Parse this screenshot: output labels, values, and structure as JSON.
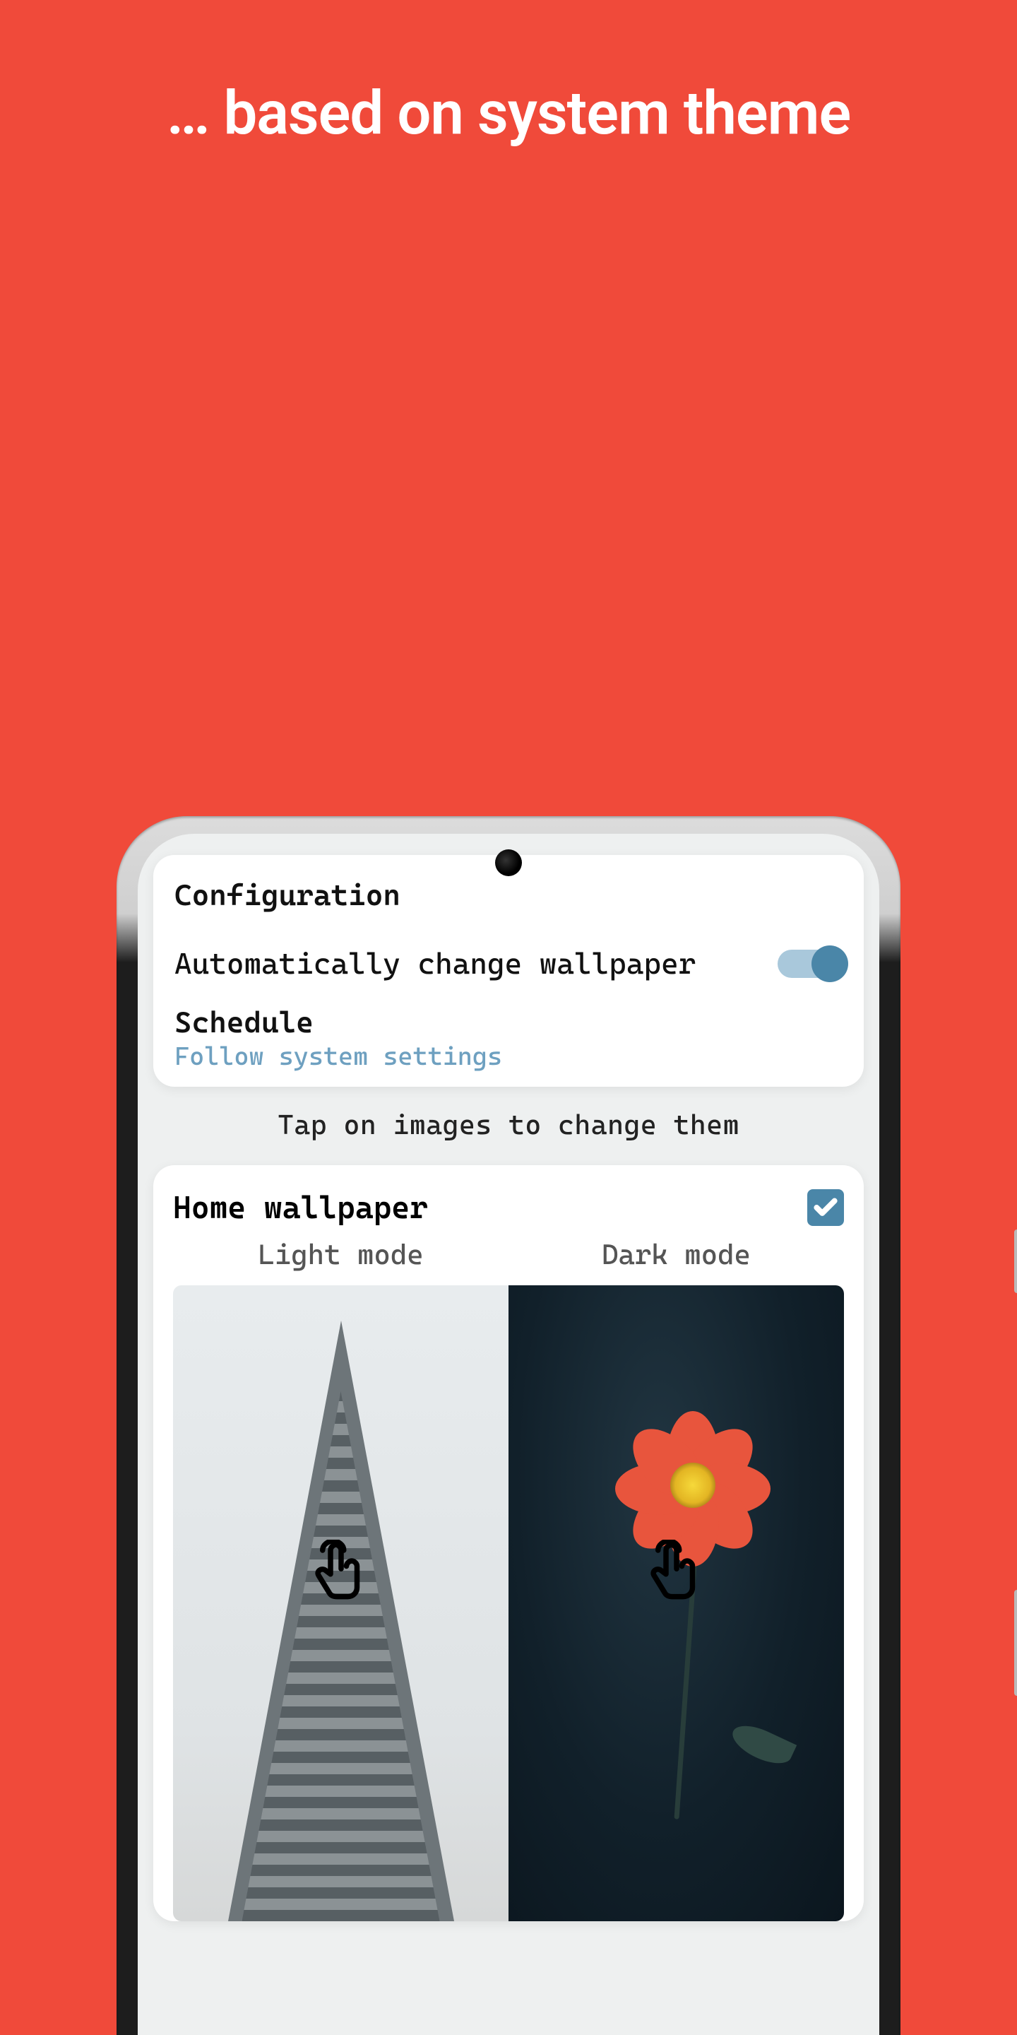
{
  "headline": "… based on system theme",
  "config": {
    "title": "Configuration",
    "auto_label": "Automatically change wallpaper",
    "auto_enabled": true,
    "schedule_label": "Schedule",
    "schedule_value": "Follow system settings"
  },
  "hint": "Tap on images to change them",
  "home": {
    "title": "Home wallpaper",
    "checked": true,
    "light_label": "Light mode",
    "dark_label": "Dark mode"
  },
  "colors": {
    "accent": "#4a86a8",
    "background": "#f04a3a"
  }
}
